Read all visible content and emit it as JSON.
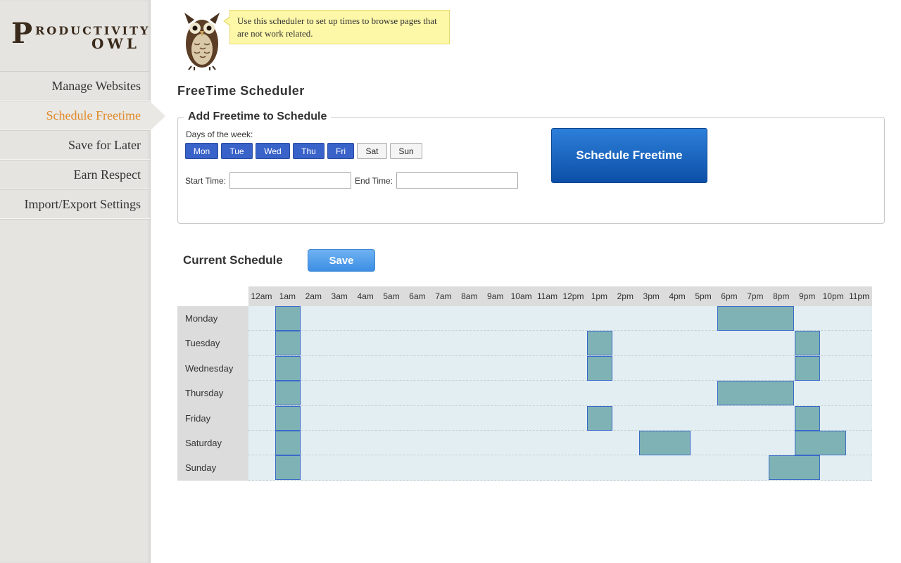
{
  "logo": {
    "first_letter": "P",
    "line1": "RODUCTIVITY",
    "line2": "OWL"
  },
  "sidebar": {
    "items": [
      {
        "label": "Manage Websites",
        "active": false
      },
      {
        "label": "Schedule Freetime",
        "active": true
      },
      {
        "label": "Save for Later",
        "active": false
      },
      {
        "label": "Earn Respect",
        "active": false
      },
      {
        "label": "Import/Export Settings",
        "active": false
      }
    ]
  },
  "tip": {
    "text": "Use this scheduler to set up times to browse pages that are not work related."
  },
  "page": {
    "title": "FreeTime Scheduler"
  },
  "add_form": {
    "legend": "Add Freetime to Schedule",
    "days_label": "Days of the week:",
    "days": [
      {
        "label": "Mon",
        "selected": true
      },
      {
        "label": "Tue",
        "selected": true
      },
      {
        "label": "Wed",
        "selected": true
      },
      {
        "label": "Thu",
        "selected": true
      },
      {
        "label": "Fri",
        "selected": true
      },
      {
        "label": "Sat",
        "selected": false
      },
      {
        "label": "Sun",
        "selected": false
      }
    ],
    "start_label": "Start Time:",
    "start_value": "",
    "end_label": "End Time:",
    "end_value": "",
    "submit_label": "Schedule Freetime"
  },
  "schedule": {
    "label": "Current Schedule",
    "save_label": "Save",
    "hours": [
      "12am",
      "1am",
      "2am",
      "3am",
      "4am",
      "5am",
      "6am",
      "7am",
      "8am",
      "9am",
      "10am",
      "11am",
      "12pm",
      "1pm",
      "2pm",
      "3pm",
      "4pm",
      "5pm",
      "6pm",
      "7pm",
      "8pm",
      "9pm",
      "10pm",
      "11pm"
    ],
    "rows": [
      {
        "day": "Monday",
        "blocks": [
          {
            "start": 1,
            "end": 2
          },
          {
            "start": 18,
            "end": 21
          }
        ]
      },
      {
        "day": "Tuesday",
        "blocks": [
          {
            "start": 1,
            "end": 2
          },
          {
            "start": 13,
            "end": 14
          },
          {
            "start": 21,
            "end": 22
          }
        ]
      },
      {
        "day": "Wednesday",
        "blocks": [
          {
            "start": 1,
            "end": 2
          },
          {
            "start": 13,
            "end": 14
          },
          {
            "start": 21,
            "end": 22
          }
        ]
      },
      {
        "day": "Thursday",
        "blocks": [
          {
            "start": 1,
            "end": 2
          },
          {
            "start": 18,
            "end": 21
          }
        ]
      },
      {
        "day": "Friday",
        "blocks": [
          {
            "start": 1,
            "end": 2
          },
          {
            "start": 13,
            "end": 14
          },
          {
            "start": 21,
            "end": 22
          }
        ]
      },
      {
        "day": "Saturday",
        "blocks": [
          {
            "start": 1,
            "end": 2
          },
          {
            "start": 15,
            "end": 17
          },
          {
            "start": 21,
            "end": 23
          }
        ]
      },
      {
        "day": "Sunday",
        "blocks": [
          {
            "start": 1,
            "end": 2
          },
          {
            "start": 20,
            "end": 22
          }
        ]
      }
    ]
  },
  "colors": {
    "accent": "#e0892a",
    "day_selected": "#3a63c9",
    "block_fill": "#7fb2b5",
    "block_border": "#3a6ac8",
    "grid_bg": "#e2eef1",
    "tip_bg": "#fdf7a8"
  }
}
